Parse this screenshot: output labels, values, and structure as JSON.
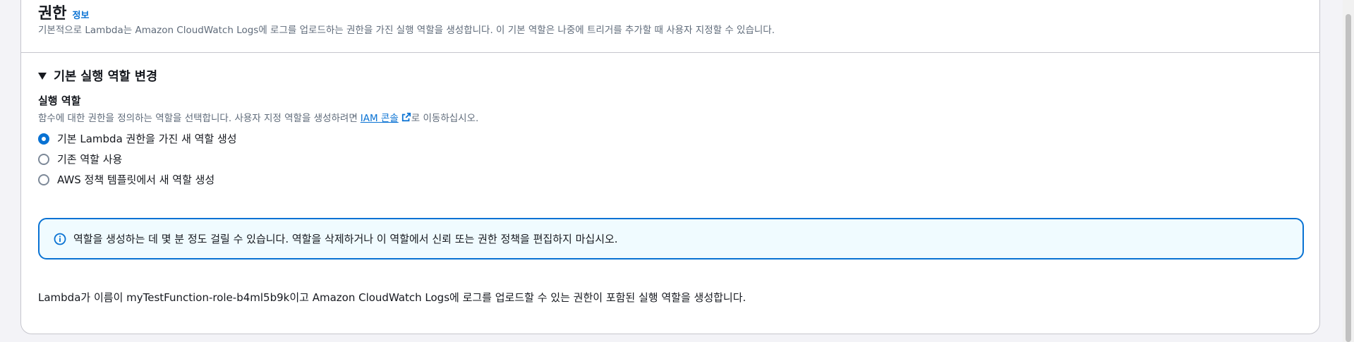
{
  "section": {
    "title": "권한",
    "info_link": "정보",
    "description": "기본적으로 Lambda는 Amazon CloudWatch Logs에 로그를 업로드하는 권한을 가진 실행 역할을 생성합니다. 이 기본 역할은 나중에 트리거를 추가할 때 사용자 지정할 수 있습니다."
  },
  "expander": {
    "label": "기본 실행 역할 변경",
    "expanded": true
  },
  "execution_role": {
    "label": "실행 역할",
    "description_prefix": "함수에 대한 권한을 정의하는 역할을 선택합니다. 사용자 지정 역할을 생성하려면",
    "iam_link": "IAM 콘솔",
    "description_suffix": "로 이동하십시오.",
    "options": [
      {
        "label": "기본 Lambda 권한을 가진 새 역할 생성",
        "checked": true
      },
      {
        "label": "기존 역할 사용",
        "checked": false
      },
      {
        "label": "AWS 정책 템플릿에서 새 역할 생성",
        "checked": false
      }
    ]
  },
  "alert": {
    "icon": "info-icon",
    "text": "역할을 생성하는 데 몇 분 정도 걸릴 수 있습니다. 역할을 삭제하거나 이 역할에서 신뢰 또는 권한 정책을 편집하지 마십시오."
  },
  "summary": "Lambda가 이름이 myTestFunction-role-b4ml5b9k이고 Amazon CloudWatch Logs에 로그를 업로드할 수 있는 권한이 포함된 실행 역할을 생성합니다.",
  "colors": {
    "link": "#0972d3",
    "alert_border": "#0972d3",
    "alert_bg": "#f0fbff",
    "text": "#16191f",
    "muted": "#5f6b7a"
  }
}
